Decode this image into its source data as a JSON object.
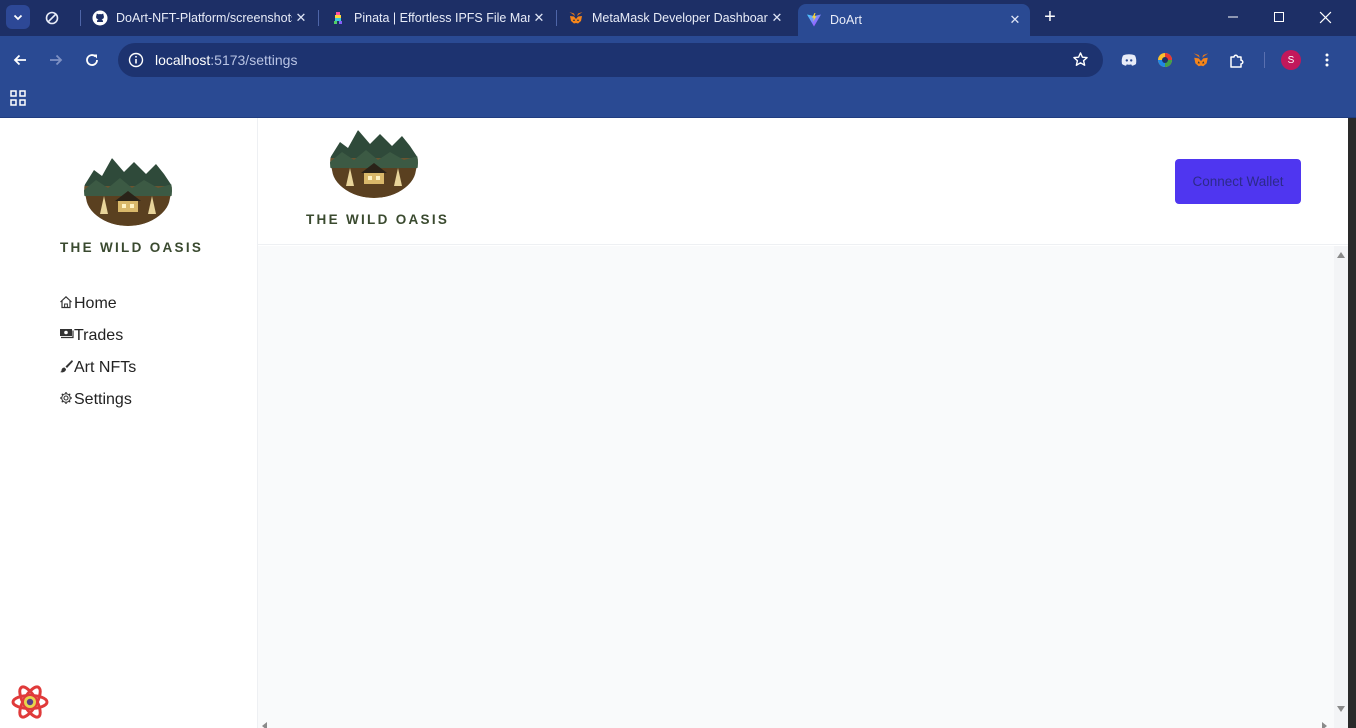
{
  "browser": {
    "tabs": [
      {
        "label": "",
        "favicon": "circle-slash-icon"
      },
      {
        "label": "DoArt-NFT-Platform/screenshots",
        "favicon": "github-icon"
      },
      {
        "label": "Pinata | Effortless IPFS File Management",
        "favicon": "pinata-icon"
      },
      {
        "label": "MetaMask Developer Dashboard",
        "favicon": "metamask-icon"
      },
      {
        "label": "DoArt",
        "favicon": "vite-icon",
        "active": true
      }
    ],
    "url_host": "localhost",
    "url_path": ":5173/settings",
    "profile_initial": "S"
  },
  "sidebar": {
    "logo_text": "THE WILD OASIS",
    "nav": [
      {
        "label": "Home",
        "icon": "home-icon"
      },
      {
        "label": "Trades",
        "icon": "trades-icon"
      },
      {
        "label": "Art NFTs",
        "icon": "brush-icon"
      },
      {
        "label": "Settings",
        "icon": "gear-icon"
      }
    ]
  },
  "header": {
    "logo_text": "THE WILD OASIS",
    "connect_button": "Connect Wallet"
  },
  "colors": {
    "browser_frame": "#1d2f66",
    "browser_toolbar": "#2a4a93",
    "connect_button": "#4f36f0",
    "main_bg": "#f9fafb"
  }
}
